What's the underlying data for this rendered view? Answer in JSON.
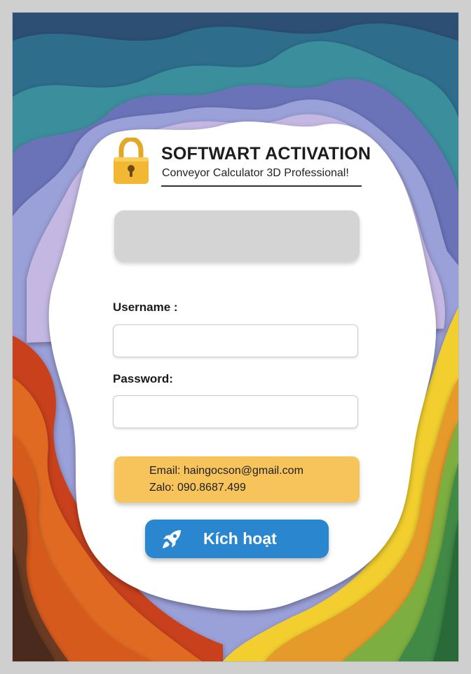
{
  "header": {
    "title": "SOFTWART ACTIVATION",
    "subtitle": "Conveyor Calculator 3D Professional!"
  },
  "form": {
    "username_label": "Username :",
    "username_value": "",
    "password_label": "Password:",
    "password_value": ""
  },
  "contact": {
    "email_line": "Email: haingocson@gmail.com",
    "zalo_line": "Zalo: 090.8687.499"
  },
  "activate_button": {
    "label": "Kích hoạt",
    "icon": "rocket-icon"
  },
  "icons": {
    "lock": "lock-icon",
    "rocket": "rocket-icon"
  },
  "colors": {
    "accent_button": "#2a86cf",
    "contact_box": "#f7c45c",
    "lock_gold": "#f2b833",
    "placeholder_bar": "#d4d4d4"
  }
}
